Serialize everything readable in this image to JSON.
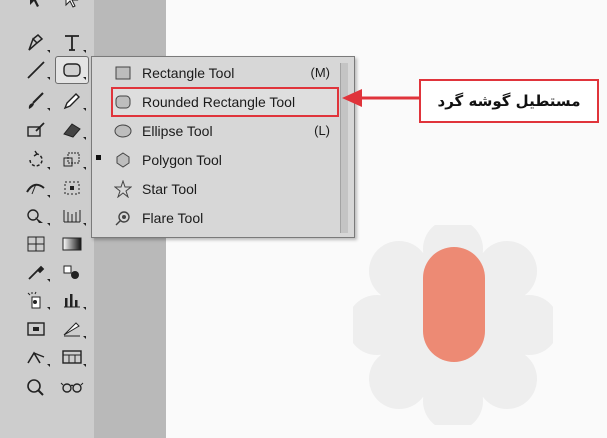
{
  "toolbar": {
    "tools": [
      {
        "name": "pen-tool",
        "icon": "pen-icon"
      },
      {
        "name": "type-tool",
        "icon": "type-icon"
      },
      {
        "name": "line-segment-tool",
        "icon": "line-icon"
      },
      {
        "name": "rectangle-tool",
        "icon": "rectangle-icon"
      },
      {
        "name": "paintbrush-tool",
        "icon": "brush-icon"
      },
      {
        "name": "pencil-tool",
        "icon": "pencil-icon"
      },
      {
        "name": "blob-brush-tool",
        "icon": "blob-icon"
      },
      {
        "name": "eraser-tool",
        "icon": "eraser-icon"
      },
      {
        "name": "rotate-tool",
        "icon": "rotate-icon"
      },
      {
        "name": "scale-tool",
        "icon": "scale-icon"
      },
      {
        "name": "width-tool",
        "icon": "width-icon"
      },
      {
        "name": "free-transform-tool",
        "icon": "free-transform-icon"
      },
      {
        "name": "shape-builder-tool",
        "icon": "shape-builder-icon"
      },
      {
        "name": "perspective-grid-tool",
        "icon": "perspective-icon"
      },
      {
        "name": "mesh-tool",
        "icon": "mesh-icon"
      },
      {
        "name": "gradient-tool",
        "icon": "gradient-icon"
      },
      {
        "name": "eyedropper-tool",
        "icon": "eyedropper-icon"
      },
      {
        "name": "blend-tool",
        "icon": "blend-icon"
      },
      {
        "name": "symbol-sprayer-tool",
        "icon": "symbol-sprayer-icon"
      },
      {
        "name": "column-graph-tool",
        "icon": "graph-icon"
      },
      {
        "name": "artboard-tool",
        "icon": "artboard-icon"
      },
      {
        "name": "slice-tool",
        "icon": "slice-icon"
      },
      {
        "name": "hand-tool",
        "icon": "hand-icon"
      },
      {
        "name": "print-tiling-tool",
        "icon": "tiling-icon"
      },
      {
        "name": "zoom-tool",
        "icon": "zoom-icon"
      },
      {
        "name": "glasses-tool",
        "icon": "glasses-icon"
      }
    ]
  },
  "flyout": {
    "items": [
      {
        "label": "Rectangle Tool",
        "shortcut": "(M)",
        "icon": "rectangle-icon"
      },
      {
        "label": "Rounded Rectangle Tool",
        "shortcut": "",
        "icon": "rounded-rectangle-icon"
      },
      {
        "label": "Ellipse Tool",
        "shortcut": "(L)",
        "icon": "ellipse-icon"
      },
      {
        "label": "Polygon Tool",
        "shortcut": "",
        "icon": "polygon-icon"
      },
      {
        "label": "Star Tool",
        "shortcut": "",
        "icon": "star-icon"
      },
      {
        "label": "Flare Tool",
        "shortcut": "",
        "icon": "flare-icon"
      }
    ],
    "selected_index": 1
  },
  "callout": {
    "text": "مستطیل گوشه گرد"
  },
  "colors": {
    "accent": "#e0343b",
    "shape_fill": "#ed8a74",
    "flower_fill": "#eeeeee"
  }
}
